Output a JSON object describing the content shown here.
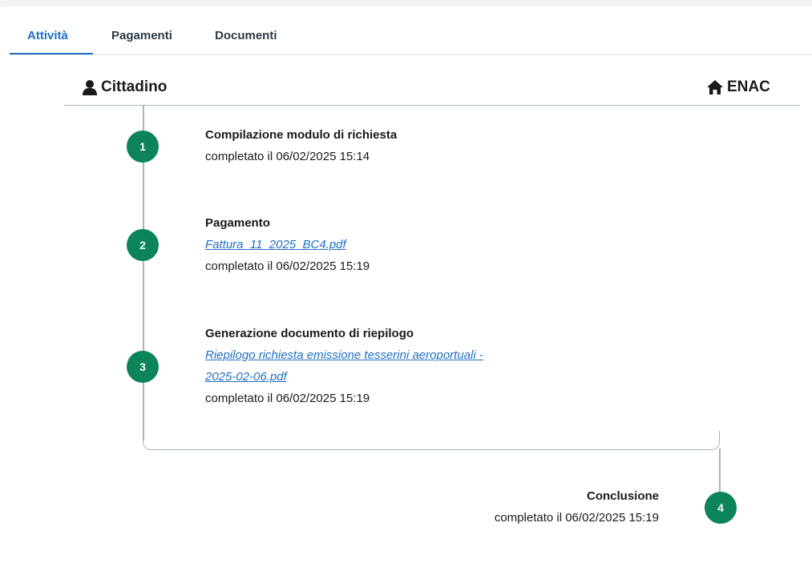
{
  "tabs": [
    {
      "label": "Attività",
      "active": true
    },
    {
      "label": "Pagamenti",
      "active": false
    },
    {
      "label": "Documenti",
      "active": false
    }
  ],
  "header": {
    "left_actor": {
      "label": "Cittadino",
      "icon": "user-icon"
    },
    "right_actor": {
      "label": "ENAC",
      "icon": "home-icon"
    }
  },
  "steps": [
    {
      "number": "1",
      "title": "Compilazione modulo di richiesta",
      "status": "completato il 06/02/2025 15:14"
    },
    {
      "number": "2",
      "title": "Pagamento",
      "link": "Fattura_11_2025_BC4.pdf",
      "status": "completato il 06/02/2025 15:19"
    },
    {
      "number": "3",
      "title": "Generazione documento di riepilogo",
      "link_line1": "Riepilogo richiesta emissione tesserini aeroportuali -",
      "link_line2": "2025-02-06.pdf",
      "status": "completato il 06/02/2025 15:19"
    },
    {
      "number": "4",
      "title": "Conclusione",
      "status": "completato il 06/02/2025 15:19"
    }
  ],
  "colors": {
    "accent": "#1f6fc3",
    "step_circle": "#0b8457",
    "line": "#a9b3bc"
  }
}
